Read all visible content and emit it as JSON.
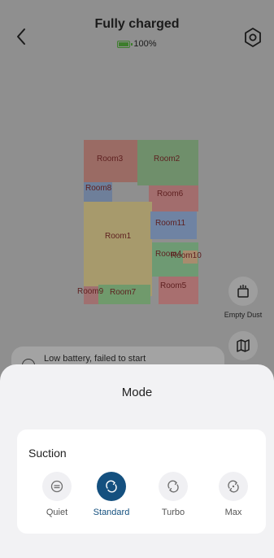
{
  "header": {
    "title": "Fully charged",
    "battery_text": "100%"
  },
  "map": {
    "rooms": [
      {
        "label": "Room3",
        "color": "#c9544a"
      },
      {
        "label": "Room2",
        "color": "#4caa45"
      },
      {
        "label": "Room8",
        "color": "#3f78d3"
      },
      {
        "label": "Room6",
        "color": "#d84b4b"
      },
      {
        "label": "Room1",
        "color": "#d9b235"
      },
      {
        "label": "Room11",
        "color": "#3d7fe0"
      },
      {
        "label": "Room4",
        "color": "#45b55a"
      },
      {
        "label": "Room10",
        "color": "#d68a2a"
      },
      {
        "label": "Room5",
        "color": "#cc4f4f"
      },
      {
        "label": "Room9",
        "color": "#d84b4b"
      },
      {
        "label": "Room7",
        "color": "#3f9e3a"
      }
    ]
  },
  "tools": {
    "empty_dust_label": "Empty Dust"
  },
  "toast": {
    "text": "Low battery, failed to start"
  },
  "sheet": {
    "title": "Mode",
    "card_title": "Suction",
    "modes": [
      {
        "label": "Quiet",
        "active": false
      },
      {
        "label": "Standard",
        "active": true
      },
      {
        "label": "Turbo",
        "active": false
      },
      {
        "label": "Max",
        "active": false
      }
    ]
  },
  "colors": {
    "accent": "#14507f",
    "overlay": "#8f8f8f",
    "sheet_bg": "#f2f2f4"
  }
}
